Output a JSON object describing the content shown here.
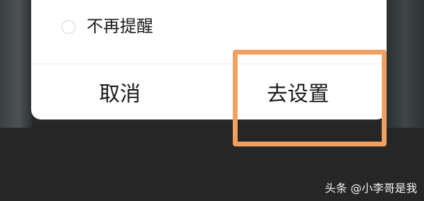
{
  "dialog": {
    "option_label": "不再提醒",
    "cancel_label": "取消",
    "settings_label": "去设置"
  },
  "watermark": {
    "text": "头条 @小李哥是我"
  },
  "colors": {
    "highlight": "#f0a060",
    "background": "#262626",
    "dialog": "#ffffff"
  }
}
